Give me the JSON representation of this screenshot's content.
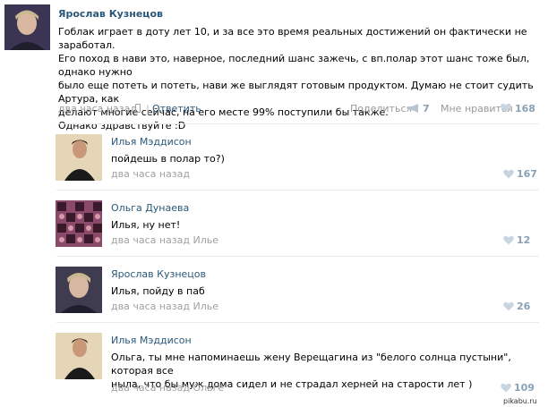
{
  "post": {
    "author": "Ярослав Кузнецов",
    "text_lines": [
      "Гоблак играет в доту лет 10, и за все это время реальных достижений он фактически не заработал.",
      "Его поход в нави это, наверное, последний шанс зажечь, с вп.полар этот шанс тоже был, однако нужно",
      "было еще потеть и потеть, нави же выглядят готовым продуктом. Думаю не стоит судить Артура, как",
      "делают многие сейчас, на его месте 99% поступили бы также.",
      "Однако здравствуйте :D"
    ],
    "time": "два часа назад",
    "separator": "|",
    "reply_label": "Ответить",
    "share_label": "Поделиться",
    "share_count": "7",
    "like_label": "Мне нравится",
    "like_count": "168"
  },
  "comments": [
    {
      "author": "Илья Мэддисон",
      "text_lines": [
        "пойдешь в полар то?)"
      ],
      "time": "два часа назад",
      "likes": "167"
    },
    {
      "author": "Ольга Дунаева",
      "text_lines": [
        "Илья, ну нет!"
      ],
      "time": "два часа назад Илье",
      "likes": "12"
    },
    {
      "author": "Ярослав Кузнецов",
      "text_lines": [
        "Илья, пойду в паб"
      ],
      "time": "два часа назад Илье",
      "likes": "26"
    },
    {
      "author": "Илья Мэддисон",
      "text_lines": [
        "Ольга, ты мне напоминаешь жену Верещагина из \"белого солнца пустыни\", которая все",
        "ныла, что бы муж дома сидел и не страдал херней на старости лет )"
      ],
      "time": "два часа назад Ольге",
      "likes": "109"
    }
  ],
  "watermark": "pikabu.ru",
  "colors": {
    "link": "#2b587a",
    "meta": "#999999",
    "count": "#8aa0b5",
    "divider": "#e6ebef"
  },
  "icons": {
    "phone": "phone-icon",
    "share": "megaphone-icon",
    "like": "heart-icon"
  }
}
